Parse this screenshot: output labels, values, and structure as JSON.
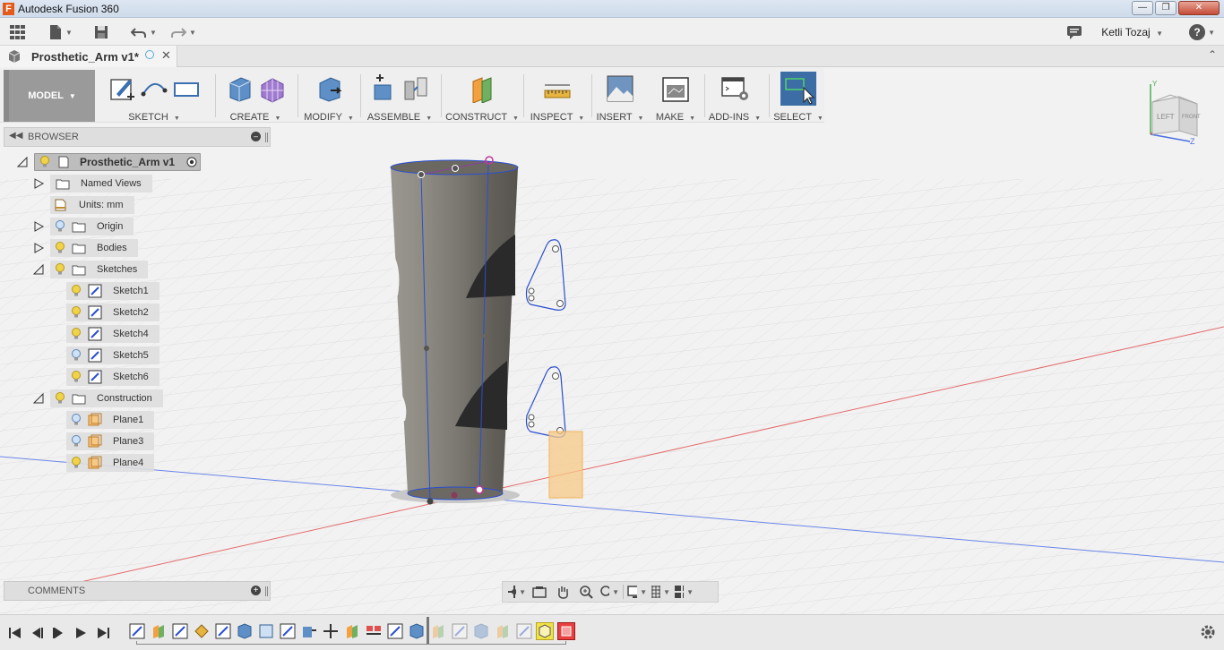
{
  "window": {
    "title": "Autodesk Fusion 360",
    "logo": "F"
  },
  "qat": {
    "user": "Ketli Tozaj",
    "help": "?"
  },
  "document": {
    "tab_name": "Prosthetic_Arm v1*"
  },
  "toolbar": {
    "workspace": "MODEL",
    "groups": [
      {
        "label": "SKETCH"
      },
      {
        "label": "CREATE"
      },
      {
        "label": "MODIFY"
      },
      {
        "label": "ASSEMBLE"
      },
      {
        "label": "CONSTRUCT"
      },
      {
        "label": "INSPECT"
      },
      {
        "label": "INSERT"
      },
      {
        "label": "MAKE"
      },
      {
        "label": "ADD-INS"
      },
      {
        "label": "SELECT"
      }
    ]
  },
  "browser": {
    "title": "BROWSER",
    "root": "Prosthetic_Arm v1",
    "items": [
      {
        "label": "Named Views"
      },
      {
        "label": "Units: mm"
      },
      {
        "label": "Origin"
      },
      {
        "label": "Bodies"
      },
      {
        "label": "Sketches"
      },
      {
        "label": "Sketch1"
      },
      {
        "label": "Sketch2"
      },
      {
        "label": "Sketch4"
      },
      {
        "label": "Sketch5"
      },
      {
        "label": "Sketch6"
      },
      {
        "label": "Construction"
      },
      {
        "label": "Plane1"
      },
      {
        "label": "Plane3"
      },
      {
        "label": "Plane4"
      }
    ]
  },
  "comments": {
    "title": "COMMENTS"
  },
  "viewcube": {
    "left": "LEFT",
    "front": "FRONT",
    "axis_y": "Y",
    "axis_z": "Z"
  },
  "colors": {
    "accent": "#4f7eaa",
    "select_active": "#3c6ea5",
    "sketch_line": "#2a4fcf",
    "origin_red": "#e05050",
    "origin_blue": "#4a6fe0",
    "plane_orange": "#f2b35a"
  }
}
